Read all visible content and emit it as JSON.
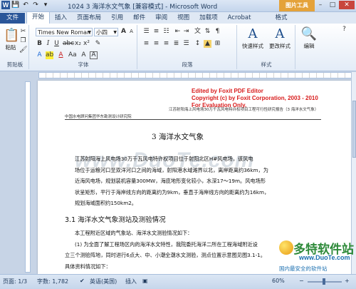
{
  "window": {
    "title": "1024 3 海洋水文气象 [兼容模式] - Microsoft Word",
    "context_tab": "图片工具",
    "minimize": "–",
    "maximize": "□",
    "close": "✕"
  },
  "tabs": [
    "文件",
    "开始",
    "插入",
    "页面布局",
    "引用",
    "邮件",
    "审阅",
    "视图",
    "加载项",
    "Acrobat",
    "格式"
  ],
  "ribbon": {
    "clipboard": {
      "paste_label": "粘贴",
      "group_label": "剪贴板"
    },
    "font": {
      "font_name": "Times New Roman",
      "font_size": "小四",
      "group_label": "字体"
    },
    "paragraph": {
      "group_label": "段落"
    },
    "styles": {
      "quick_styles": "快速样式",
      "change_styles": "更改样式",
      "group_label": "样式"
    },
    "editing": {
      "label": "编辑"
    }
  },
  "document": {
    "foxit_lines": [
      "Edited by Foxit PDF Editor",
      "Copyright (c) by Foxit Corporation, 2003 - 2010",
      "For Evaluation Only."
    ],
    "header_left": "中国水电顾问集团华东勘测设计研究院",
    "header_right": "江苏射阳海上风电场30万千瓦风电特许权项目工程可行性研究报告（3 海洋水文气象）",
    "watermark": "www.DuoTe.com",
    "heading1": "3    海洋水文气象",
    "para1": [
      "江苏射阳海上风电场30万千瓦风电特许权项目位于射阳北区H#风电场，该风电",
      "场位于运粮河口至双洋河口之间的海域，射阳港水域滩界以北，离岸距离约36km，为",
      "近海风电场，规划装机容量300MW，海底地形变化较小，水深17～19m。风电场形",
      "状呈矩形，平行于海岸线方向的距离约为9km，垂直于海岸线方向的距离约为16km，",
      "规划海域面积约150km2。"
    ],
    "heading2": "3.1    海洋水文气象测站及测验情况",
    "para2": [
      "本工程附近区域的气象站、海洋水文测验情况如下：",
      "(1) 为全面了解工程场区内的海洋水文特性，我院委托海洋二所在工程海域附近设",
      "立三个测验阵地，同时进行6点大、中、小潮全潮水文测验，测点位置示意图见图3.1-1。",
      "具体资料情况如下："
    ]
  },
  "status": {
    "page": "页面: 1/3",
    "words": "字数: 1,782",
    "lang": "英语(美国)",
    "insert": "插入",
    "zoom": "60%"
  },
  "zoom_level": 0.6,
  "logo": {
    "name": "多特软件站",
    "url": "www.DuoTe.com",
    "tagline": "国内最安全的软件站"
  }
}
